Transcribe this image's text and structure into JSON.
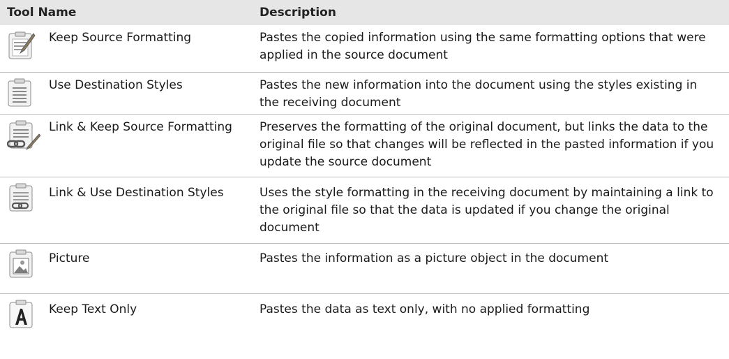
{
  "header": {
    "col_name": "Tool Name",
    "col_description": "Description"
  },
  "rows": [
    {
      "icon": "keep-source-formatting-icon",
      "name": "Keep Source Formatting",
      "description": "Pastes the copied information using the same formatting options that were applied in the source document"
    },
    {
      "icon": "use-destination-styles-icon",
      "name": "Use Destination Styles",
      "description": "Pastes the new information into the document using the styles existing in the receiving document"
    },
    {
      "icon": "link-keep-source-formatting-icon",
      "name": "Link & Keep Source Formatting",
      "description": "Preserves the formatting of the original document, but links the data to the original file so that changes will be reflected in the pasted information if you update the source document"
    },
    {
      "icon": "link-use-destination-styles-icon",
      "name": "Link & Use Destination Styles",
      "description": "Uses the style formatting in the receiving document by maintaining a link to the original file so that the data is updated if you change the original document"
    },
    {
      "icon": "picture-icon",
      "name": "Picture",
      "description": "Pastes the information as a picture object in the document"
    },
    {
      "icon": "keep-text-only-icon",
      "name": "Keep Text Only",
      "description": "Pastes the data as text only, with no applied formatting"
    }
  ]
}
